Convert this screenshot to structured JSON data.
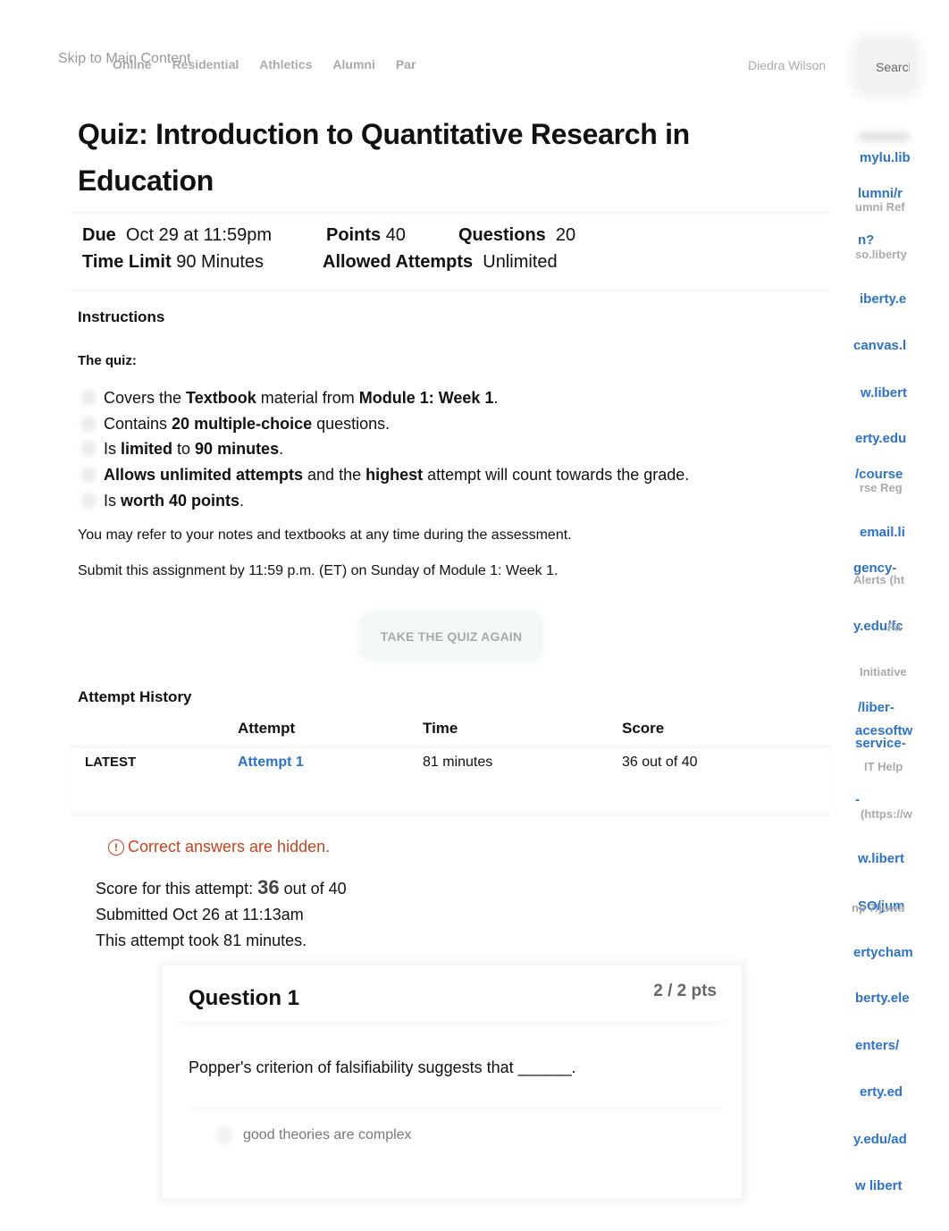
{
  "header": {
    "skip_link": "Skip to Main Content",
    "nav": [
      "Online",
      "Residential",
      "Athletics",
      "Alumni",
      "Par"
    ],
    "user_name": "Diedra Wilson",
    "search_label": "Search"
  },
  "sidebar_fragments": [
    {
      "text": "mylu.lib",
      "style": "link"
    },
    {
      "text": "lumni/r",
      "style": "link"
    },
    {
      "text": "umni Ref",
      "style": "gray"
    },
    {
      "text": "n?",
      "style": "link"
    },
    {
      "text": "so.liberty",
      "style": "gray"
    },
    {
      "text": "iberty.e",
      "style": "link"
    },
    {
      "text": "canvas.l",
      "style": "link"
    },
    {
      "text": "w.libert",
      "style": "link"
    },
    {
      "text": "erty.edu",
      "style": "link"
    },
    {
      "text": "/course",
      "style": "link"
    },
    {
      "text": "rse Reg",
      "style": "gray"
    },
    {
      "text": "email.li",
      "style": "link"
    },
    {
      "text": "gency-",
      "style": "link"
    },
    {
      "text": "Alerts (ht",
      "style": "gray"
    },
    {
      "text": "y.edu/fc",
      "style": "link"
    },
    {
      "text": "Fa",
      "style": "gray"
    },
    {
      "text": "Initiative",
      "style": "gray"
    },
    {
      "text": "/liber-",
      "style": "link"
    },
    {
      "text": "acesoftw",
      "style": "link"
    },
    {
      "text": "service-",
      "style": "link"
    },
    {
      "text": "IT Help",
      "style": "gray"
    },
    {
      "text": "-",
      "style": "link"
    },
    {
      "text": "(https://w",
      "style": "gray"
    },
    {
      "text": "w.libert",
      "style": "link"
    },
    {
      "text": "SO/jum",
      "style": "link"
    },
    {
      "text": "np 7/juwa",
      "style": "gray"
    },
    {
      "text": "ertycham",
      "style": "link"
    },
    {
      "text": "berty.ele",
      "style": "link"
    },
    {
      "text": "enters/",
      "style": "link"
    },
    {
      "text": "y.edu/ad",
      "style": "link"
    },
    {
      "text": "erty.ed",
      "style": "link"
    },
    {
      "text": "w libert",
      "style": "link"
    }
  ],
  "quiz": {
    "title": "Quiz: Introduction to Quantitative Research in Education",
    "meta": {
      "due_label": "Due",
      "due_value": "Oct 29 at 11:59pm",
      "points_label": "Points",
      "points_value": "40",
      "questions_label": "Questions",
      "questions_value": "20",
      "time_limit_label": "Time Limit",
      "time_limit_value": "90 Minutes",
      "attempts_label": "Allowed Attempts",
      "attempts_value": "Unlimited"
    },
    "instructions_heading": "Instructions",
    "quiz_subheading": "The quiz:",
    "list": [
      [
        {
          "t": "Covers the ",
          "b": false
        },
        {
          "t": "Textbook",
          "b": true
        },
        {
          "t": " material from ",
          "b": false
        },
        {
          "t": "Module 1: Week 1",
          "b": true
        },
        {
          "t": ".",
          "b": false
        }
      ],
      [
        {
          "t": "Contains ",
          "b": false
        },
        {
          "t": "20 multiple-choice",
          "b": true
        },
        {
          "t": " questions.",
          "b": false
        }
      ],
      [
        {
          "t": "Is ",
          "b": false
        },
        {
          "t": "limited",
          "b": true
        },
        {
          "t": " to ",
          "b": false
        },
        {
          "t": "90 minutes",
          "b": true
        },
        {
          "t": ".",
          "b": false
        }
      ],
      [
        {
          "t": "Allows unlimited attempts",
          "b": true
        },
        {
          "t": " and the ",
          "b": false
        },
        {
          "t": "highest",
          "b": true
        },
        {
          "t": " attempt will count towards the grade.",
          "b": false
        }
      ],
      [
        {
          "t": "Is ",
          "b": false
        },
        {
          "t": "worth 40 points",
          "b": true
        },
        {
          "t": ".",
          "b": false
        }
      ]
    ],
    "note_refer": "You may refer to your notes and textbooks at any time during the assessment.",
    "note_submit": "Submit this assignment by 11:59 p.m. (ET) on Sunday of Module 1: Week 1.",
    "take_again_button": "TAKE THE QUIZ AGAIN"
  },
  "attempt_history": {
    "heading": "Attempt History",
    "columns": [
      "",
      "Attempt",
      "Time",
      "Score"
    ],
    "rows": [
      {
        "tag": "LATEST",
        "attempt": "Attempt 1",
        "time": "81 minutes",
        "score": "36 out of 40"
      }
    ]
  },
  "result": {
    "hidden_note": "Correct answers are hidden.",
    "score_prefix": "Score for this attempt: ",
    "score_value": "36",
    "score_suffix": " out of 40",
    "submitted": "Submitted Oct 26 at 11:13am",
    "duration": "This attempt took 81 minutes."
  },
  "question": {
    "title": "Question 1",
    "points": "2 / 2 pts",
    "text": "Popper's criterion of falsifiability suggests that ______.",
    "answers": [
      "good theories are complex"
    ]
  },
  "colors": {
    "link": "#2d73c9",
    "warning": "#c8431b",
    "muted": "#aaaaaa"
  }
}
